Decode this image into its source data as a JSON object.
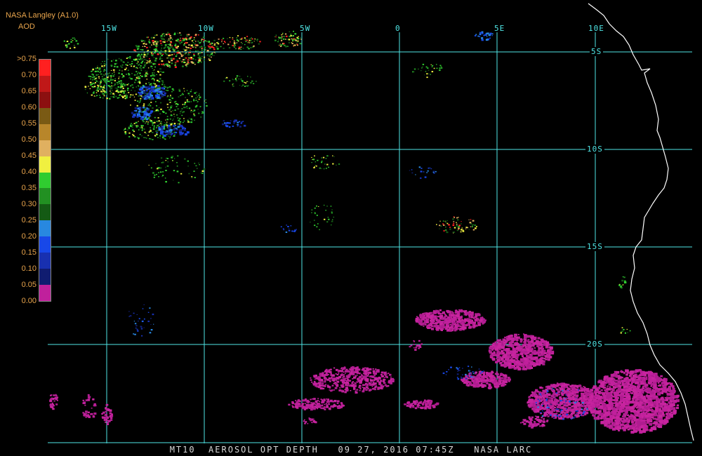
{
  "header": {
    "source": "NASA Langley (A1.0)",
    "variable": "AOD"
  },
  "legend": {
    "labels": [
      ">0.75",
      "0.70",
      "0.65",
      "0.60",
      "0.55",
      "0.50",
      "0.45",
      "0.40",
      "0.35",
      "0.30",
      "0.25",
      "0.20",
      "0.15",
      "0.10",
      "0.05",
      "0.00"
    ],
    "colors": [
      "#ff2020",
      "#c01818",
      "#8c1010",
      "#7a5a14",
      "#b8862a",
      "#e0b060",
      "#f0f040",
      "#30cc30",
      "#229022",
      "#145a14",
      "#2888e0",
      "#1848e8",
      "#1830b0",
      "#101c70",
      "#c0209c",
      "#c0209c"
    ]
  },
  "grid": {
    "lon_labels": [
      "15W",
      "10W",
      "5W",
      "0",
      "5E",
      "10E"
    ],
    "lat_labels": [
      "5S",
      "10S",
      "15S",
      "20S"
    ]
  },
  "colors": {
    "grid": "#4fe6e6",
    "coast": "#ffffff",
    "aerosol_high": "#c0209c"
  },
  "footer": {
    "text": "MT10  AEROSOL OPT DEPTH   09 27, 2016 07:45Z   NASA LARC"
  }
}
